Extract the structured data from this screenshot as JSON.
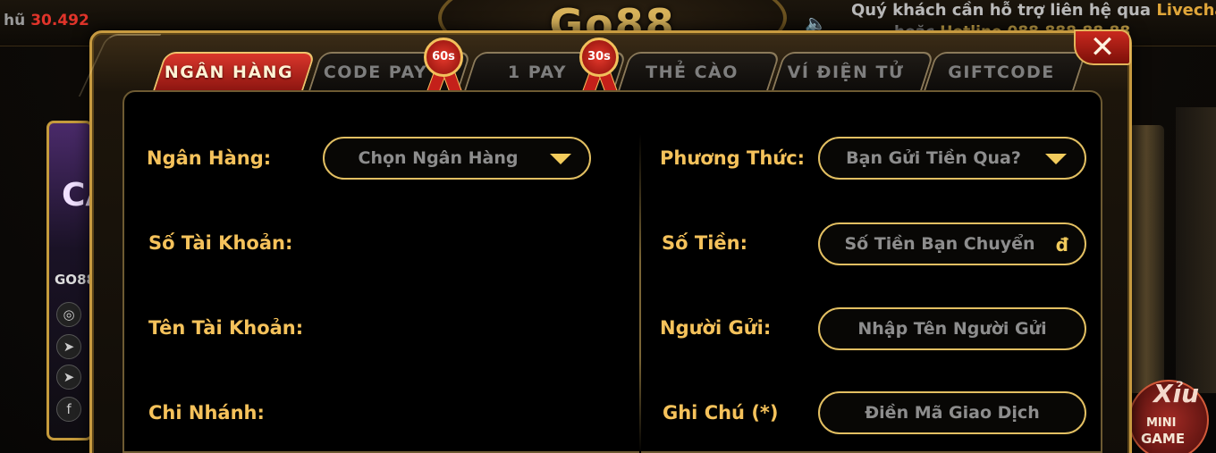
{
  "hud": {
    "balance_label": "hũ",
    "balance_value": "30.492",
    "logo_text": "Go88",
    "support_text": "Quý khách cần hỗ trợ liên hệ qua",
    "support_link": "Livechat",
    "hotline_prefix": "hoặc",
    "hotline_label": "Hotline",
    "hotline_number": "088.888.88.88",
    "promo_text": "CA",
    "promo_id": "GO88",
    "minigame_xiu": "Xỉu",
    "minigame_line1": "MINI",
    "minigame_line2": "GAME"
  },
  "modal": {
    "close_label": "✕",
    "tabs": [
      {
        "label": "NGÂN HÀNG",
        "active": true
      },
      {
        "label": "CODE PAY",
        "active": false,
        "badge": "60s"
      },
      {
        "label": "1 PAY",
        "active": false,
        "badge": "30s"
      },
      {
        "label": "THẺ CÀO",
        "active": false
      },
      {
        "label": "VÍ ĐIỆN TỬ",
        "active": false
      },
      {
        "label": "GIFTCODE",
        "active": false
      }
    ],
    "left": {
      "bank_label": "Ngân Hàng:",
      "bank_select_placeholder": "Chọn Ngân Hàng",
      "account_number_label": "Số Tài Khoản:",
      "account_name_label": "Tên Tài Khoản:",
      "branch_label": "Chi Nhánh:"
    },
    "right": {
      "method_label": "Phương Thức:",
      "method_select_placeholder": "Bạn Gửi Tiền Qua?",
      "amount_label": "Số Tiền:",
      "amount_placeholder": "Số Tiền Bạn Chuyển",
      "amount_unit": "đ",
      "sender_label": "Người Gửi:",
      "sender_placeholder": "Nhập Tên Người Gửi",
      "note_label": "Ghi Chú (*)",
      "note_placeholder": "Điền Mã Giao Dịch"
    }
  },
  "colors": {
    "accent_gold": "#f5c25b",
    "active_tab_red": "#d9362b",
    "balance_red": "#e0342a",
    "placeholder_gray": "#8d8d8d"
  }
}
